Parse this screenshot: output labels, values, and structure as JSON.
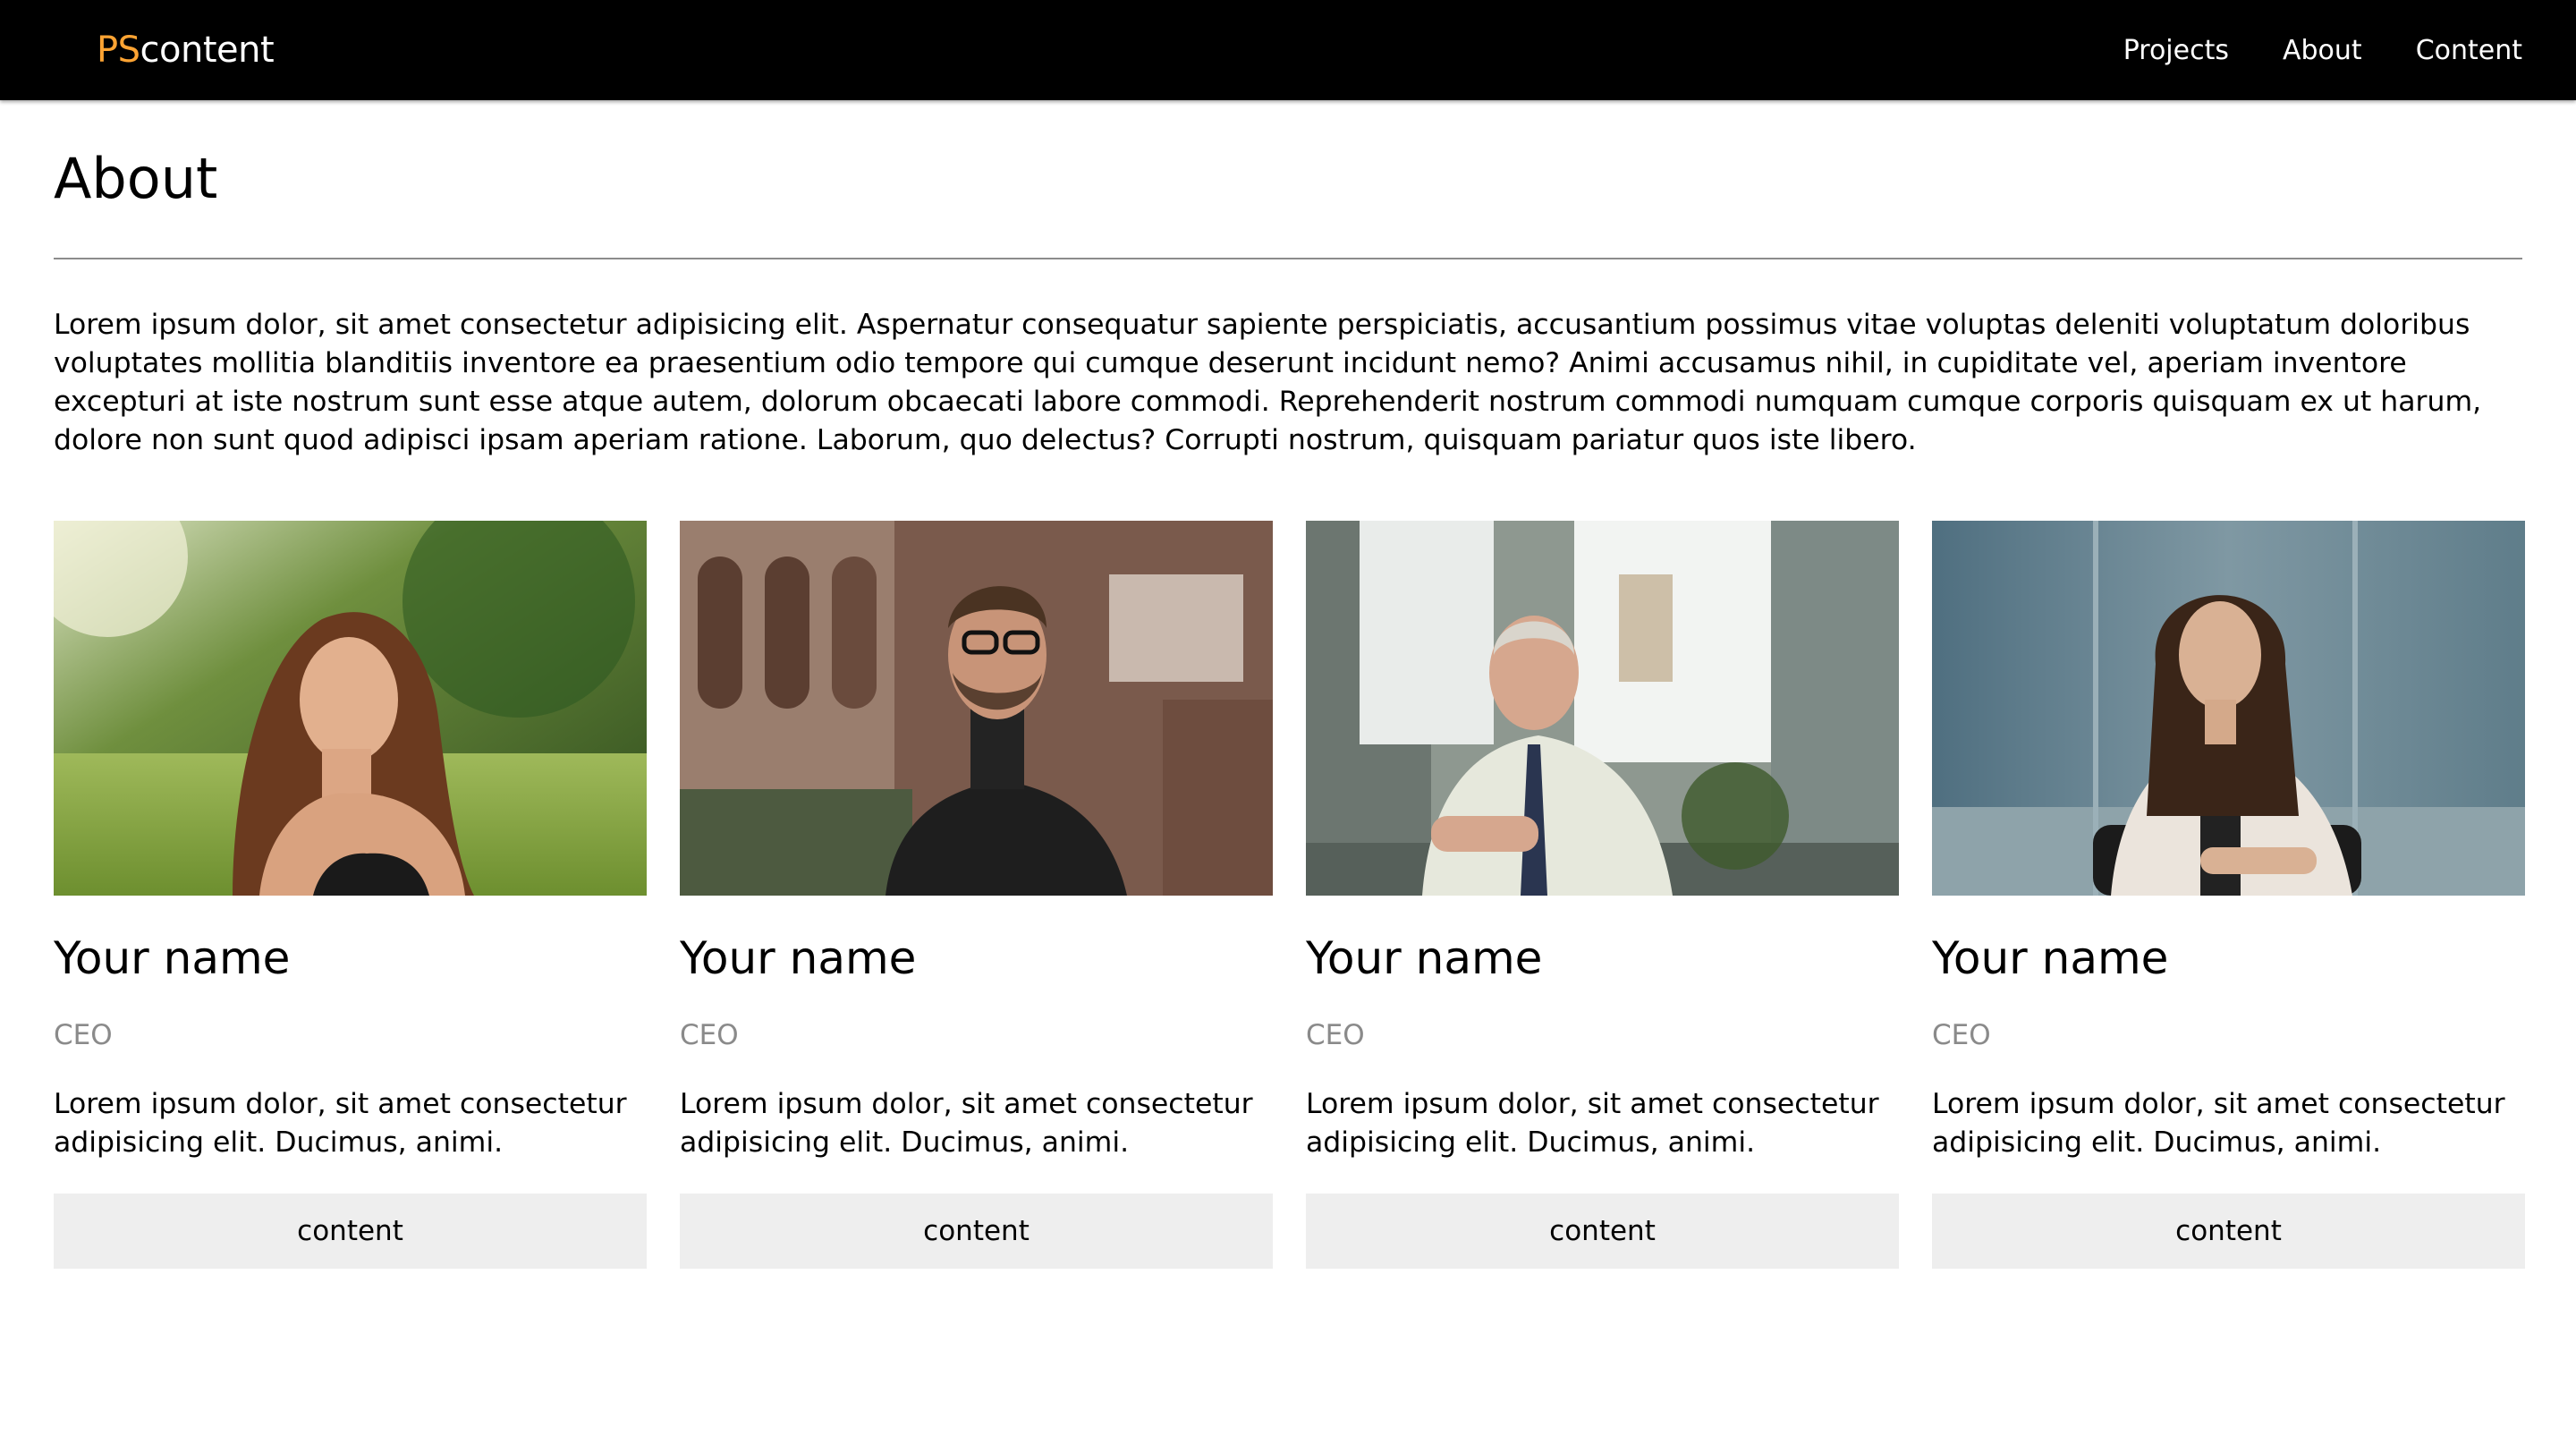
{
  "nav": {
    "brand_accent": "PS",
    "brand_text": "content",
    "links": [
      "Projects",
      "About",
      "Content"
    ]
  },
  "page": {
    "title": "About",
    "intro": "Lorem ipsum dolor, sit amet consectetur adipisicing elit. Aspernatur consequatur sapiente perspiciatis, accusantium possimus vitae voluptas deleniti voluptatum doloribus voluptates mollitia blanditiis inventore ea praesentium odio tempore qui cumque deserunt incidunt nemo? Animi accusamus nihil, in cupiditate vel, aperiam inventore excepturi at iste nostrum sunt esse atque autem, dolorum obcaecati labore commodi. Reprehenderit nostrum commodi numquam cumque corporis quisquam ex ut harum, dolore non sunt quod adipisci ipsam aperiam ratione. Laborum, quo delectus? Corrupti nostrum, quisquam pariatur quos iste libero."
  },
  "team": [
    {
      "name": "Your name",
      "role": "CEO",
      "bio": "Lorem ipsum dolor, sit amet consectetur adipisicing elit. Ducimus, animi.",
      "button": "content"
    },
    {
      "name": "Your name",
      "role": "CEO",
      "bio": "Lorem ipsum dolor, sit amet consectetur adipisicing elit. Ducimus, animi.",
      "button": "content"
    },
    {
      "name": "Your name",
      "role": "CEO",
      "bio": "Lorem ipsum dolor, sit amet consectetur adipisicing elit. Ducimus, animi.",
      "button": "content"
    },
    {
      "name": "Your name",
      "role": "CEO",
      "bio": "Lorem ipsum dolor, sit amet consectetur adipisicing elit. Ducimus, animi.",
      "button": "content"
    }
  ],
  "colors": {
    "navbar_bg": "#000000",
    "brand_accent": "#ffa433",
    "role_text": "#8a8a8a",
    "button_bg": "#eeeeee",
    "divider": "#8c8c8c"
  }
}
